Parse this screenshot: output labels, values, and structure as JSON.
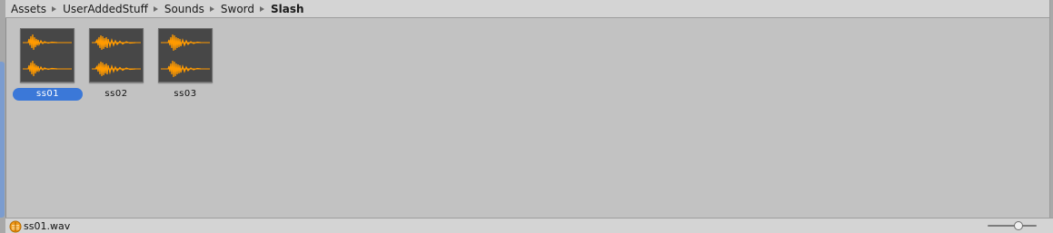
{
  "breadcrumb": {
    "items": [
      "Assets",
      "UserAddedStuff",
      "Sounds",
      "Sword"
    ],
    "current": "Slash"
  },
  "assets": [
    {
      "label": "ss01",
      "selected": true
    },
    {
      "label": "ss02",
      "selected": false
    },
    {
      "label": "ss03",
      "selected": false
    }
  ],
  "status": {
    "file_name": "ss01.wav",
    "icon": "audio-file-icon"
  },
  "zoom": {
    "level": 0.65
  },
  "colors": {
    "waveform": "#ff9a00",
    "thumbnail_bg": "#474747",
    "selection": "#3b78d8",
    "panel_bg": "#c2c2c2"
  }
}
